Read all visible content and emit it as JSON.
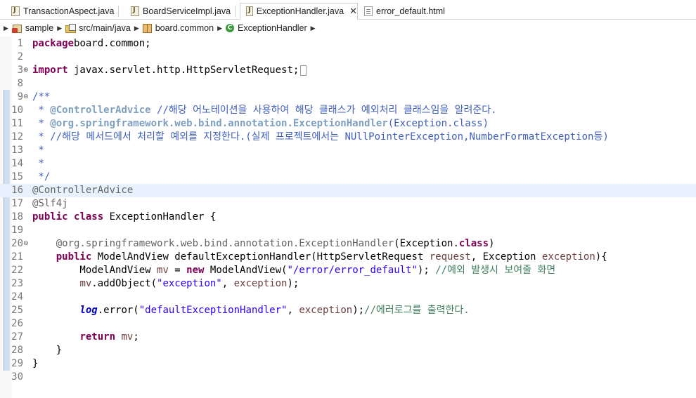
{
  "tabs": [
    {
      "label": "TransactionAspect.java",
      "type": "java",
      "active": false
    },
    {
      "label": "BoardServiceImpl.java",
      "type": "java",
      "active": false
    },
    {
      "label": "ExceptionHandler.java",
      "type": "java",
      "active": true
    },
    {
      "label": "error_default.html",
      "type": "html",
      "active": false
    }
  ],
  "breadcrumb": [
    "sample",
    "src/main/java",
    "board.common",
    "ExceptionHandler"
  ],
  "code_lines": [
    {
      "n": "1",
      "tokens": [
        [
          "kw",
          "package"
        ],
        [
          "",
          "board.common;"
        ]
      ]
    },
    {
      "n": "2",
      "tokens": []
    },
    {
      "n": "3",
      "fold": "⊕",
      "tokens": [
        [
          "kw",
          "import"
        ],
        [
          "",
          " javax.servlet.http.HttpServletRequest;"
        ]
      ],
      "collapsed": true
    },
    {
      "n": "8",
      "tokens": []
    },
    {
      "n": "9",
      "fold": "⊖",
      "tokens": [
        [
          "jd",
          "/**"
        ]
      ]
    },
    {
      "n": "10",
      "tokens": [
        [
          "jd",
          " * "
        ],
        [
          "jdtag",
          "@ControllerAdvice"
        ],
        [
          "jd",
          " //해당 어노테이션을 사용하여 해당 클래스가 예외처리 클래스임을 알려준다."
        ]
      ]
    },
    {
      "n": "11",
      "tokens": [
        [
          "jd",
          " * "
        ],
        [
          "jdtag",
          "@org.springframework.web.bind.annotation.ExceptionHandler"
        ],
        [
          "jd",
          "(Exception.class)"
        ]
      ]
    },
    {
      "n": "12",
      "tokens": [
        [
          "jd",
          " * //해당 메서드에서 처리할 예외를 지정한다.(실제 프로젝트에서는 NUllPointerException,NumberFormatException등)"
        ]
      ]
    },
    {
      "n": "13",
      "tokens": [
        [
          "jd",
          " *"
        ]
      ]
    },
    {
      "n": "14",
      "tokens": [
        [
          "jd",
          " *"
        ]
      ]
    },
    {
      "n": "15",
      "tokens": [
        [
          "jd",
          " */"
        ]
      ]
    },
    {
      "n": "16",
      "hl": true,
      "tokens": [
        [
          "ann",
          "@ControllerAdvice"
        ]
      ]
    },
    {
      "n": "17",
      "tokens": [
        [
          "ann",
          "@Slf4j"
        ]
      ]
    },
    {
      "n": "18",
      "tokens": [
        [
          "kw",
          "public"
        ],
        [
          "",
          " "
        ],
        [
          "kw",
          "class"
        ],
        [
          "",
          " ExceptionHandler {"
        ]
      ]
    },
    {
      "n": "19",
      "tokens": []
    },
    {
      "n": "20",
      "fold": "⊖",
      "tokens": [
        [
          "",
          "    "
        ],
        [
          "ann",
          "@org.springframework.web.bind.annotation."
        ],
        [
          "ann",
          "ExceptionHandler"
        ],
        [
          "",
          "(Exception."
        ],
        [
          "kw",
          "class"
        ],
        [
          "",
          ")"
        ]
      ]
    },
    {
      "n": "21",
      "tokens": [
        [
          "",
          "    "
        ],
        [
          "kw",
          "public"
        ],
        [
          "",
          " ModelAndView defaultExceptionHandler(HttpServletRequest "
        ],
        [
          "var",
          "request"
        ],
        [
          "",
          ", Exception "
        ],
        [
          "var",
          "exception"
        ],
        [
          "",
          "){"
        ]
      ]
    },
    {
      "n": "22",
      "tokens": [
        [
          "",
          "        ModelAndView "
        ],
        [
          "var",
          "mv"
        ],
        [
          "",
          " = "
        ],
        [
          "kw",
          "new"
        ],
        [
          "",
          " ModelAndView("
        ],
        [
          "str",
          "\"/error/error_default\""
        ],
        [
          "",
          "); "
        ],
        [
          "cm",
          "//예외 발생시 보여줄 화면"
        ]
      ]
    },
    {
      "n": "23",
      "tokens": [
        [
          "",
          "        "
        ],
        [
          "var",
          "mv"
        ],
        [
          "",
          ".addObject("
        ],
        [
          "str",
          "\"exception\""
        ],
        [
          "",
          ", "
        ],
        [
          "var",
          "exception"
        ],
        [
          "",
          ");"
        ]
      ]
    },
    {
      "n": "24",
      "tokens": []
    },
    {
      "n": "25",
      "tokens": [
        [
          "",
          "        "
        ],
        [
          "static",
          "log"
        ],
        [
          "",
          ".error("
        ],
        [
          "str",
          "\"defaultExceptionHandler\""
        ],
        [
          "",
          ", "
        ],
        [
          "var",
          "exception"
        ],
        [
          "",
          ");"
        ],
        [
          "cm",
          "//에러로그를 출력한다."
        ]
      ]
    },
    {
      "n": "26",
      "tokens": []
    },
    {
      "n": "27",
      "tokens": [
        [
          "",
          "        "
        ],
        [
          "kw",
          "return"
        ],
        [
          "",
          " "
        ],
        [
          "var",
          "mv"
        ],
        [
          "",
          ";"
        ]
      ]
    },
    {
      "n": "28",
      "tokens": [
        [
          "",
          "    }"
        ]
      ]
    },
    {
      "n": "29",
      "tokens": [
        [
          "",
          "}"
        ]
      ]
    },
    {
      "n": "30",
      "tokens": []
    }
  ]
}
